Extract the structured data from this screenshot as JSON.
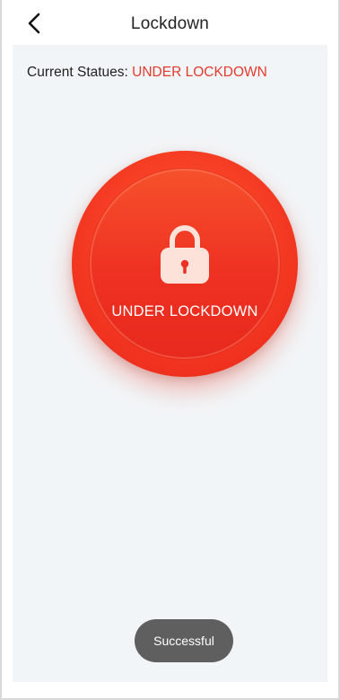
{
  "header": {
    "title": "Lockdown",
    "back_icon": "chevron-left-icon"
  },
  "status": {
    "label": "Current Statues: ",
    "value": "UNDER LOCKDOWN",
    "value_color": "#e23b2e"
  },
  "lock_button": {
    "icon": "lock-icon",
    "label": "UNDER LOCKDOWN",
    "color": "#f43a22"
  },
  "toast": {
    "message": "Successful"
  }
}
